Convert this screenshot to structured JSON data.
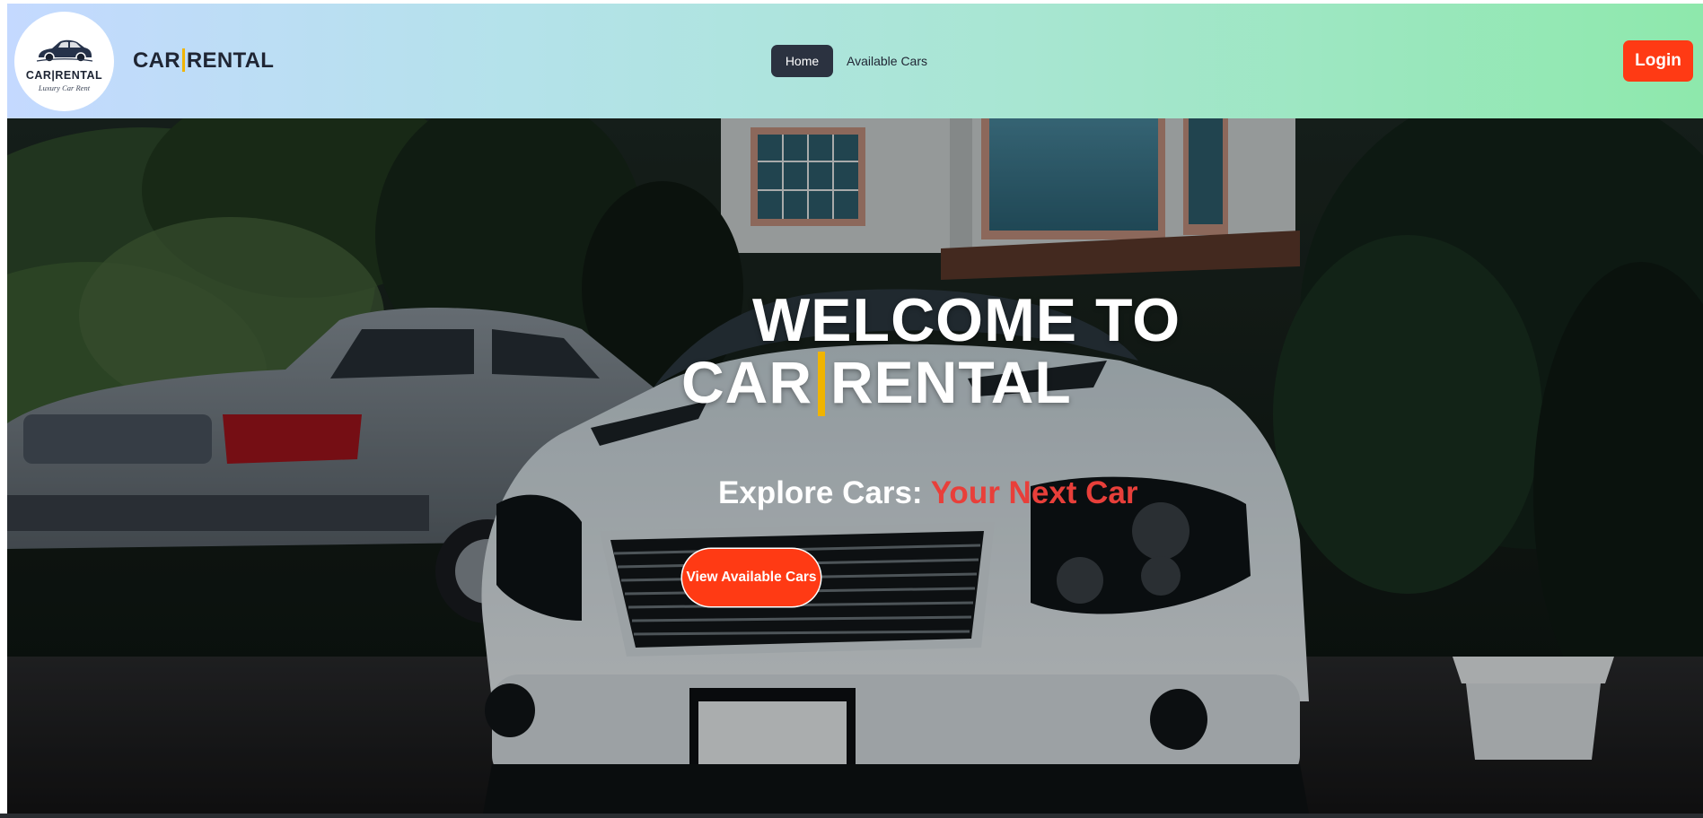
{
  "navbar": {
    "logo": {
      "main": "CAR|RENTAL",
      "sub": "Luxury Car Rent"
    },
    "brand_left": "CAR",
    "brand_right": "RENTAL",
    "links": [
      {
        "label": "Home",
        "active": true
      },
      {
        "label": "Available Cars",
        "active": false
      }
    ],
    "login_label": "Login"
  },
  "hero": {
    "title_line1": "WELCOME TO",
    "title_left": "CAR",
    "title_right": "RENTAL",
    "subtitle_lead": "Explore Cars:",
    "subtitle_accent": "Your Next Car",
    "cta_label": "View Available Cars"
  },
  "colors": {
    "accent_orange": "#ff3a14",
    "divider_gold": "#f0b400",
    "subtitle_red": "#e83f3a",
    "nav_active": "#2b3240"
  }
}
